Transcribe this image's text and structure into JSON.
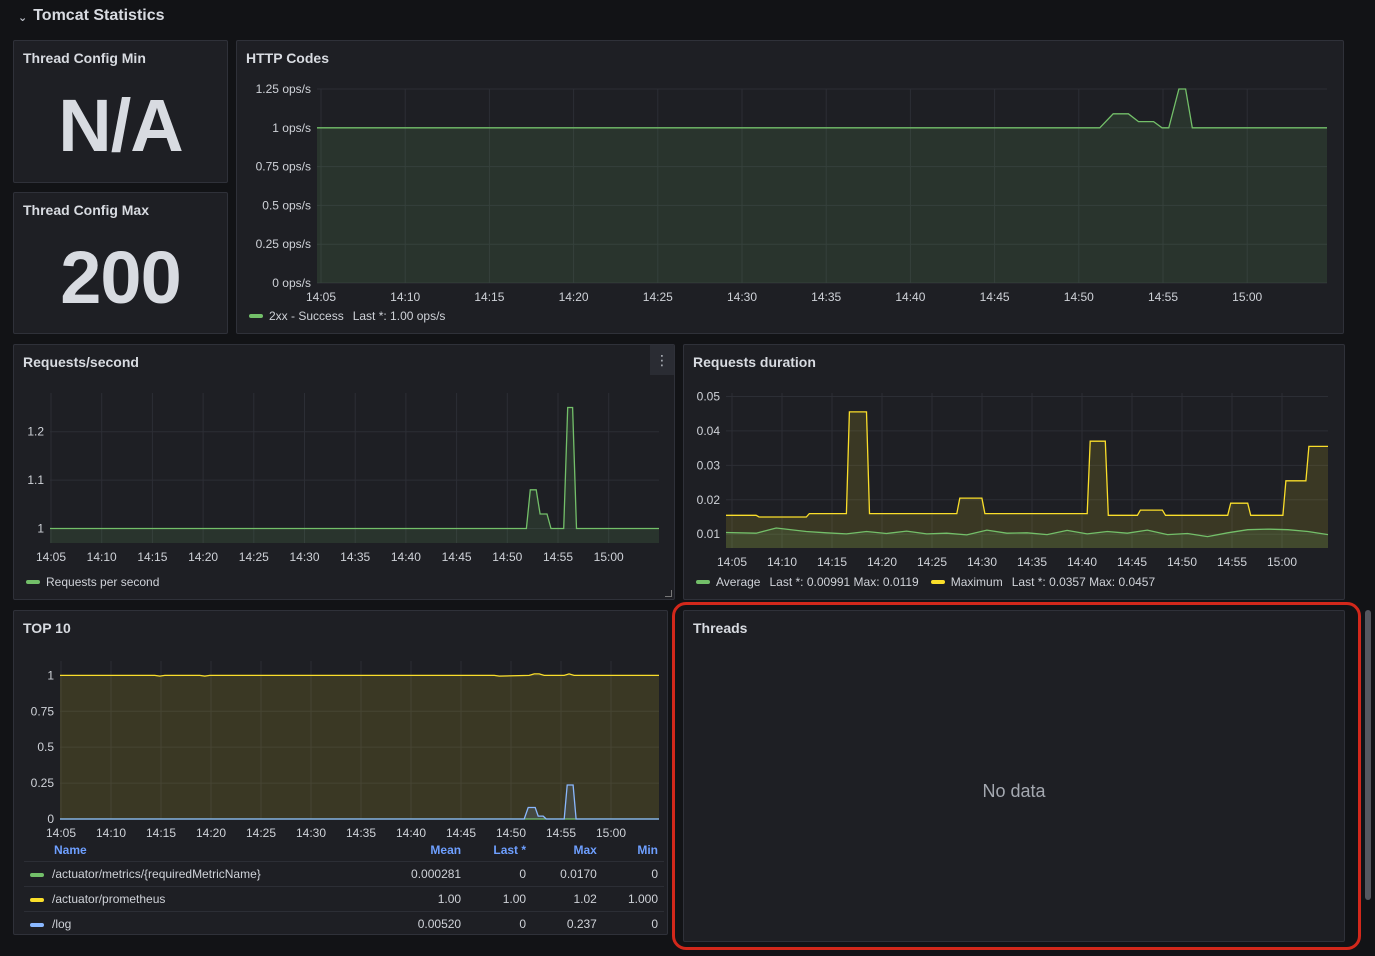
{
  "row": {
    "title": "Tomcat Statistics"
  },
  "colors": {
    "green": "#73bf69",
    "yellow": "#fade2a",
    "blue": "#8ab8ff",
    "red_highlight": "#d2281b"
  },
  "stat_min": {
    "title": "Thread Config Min",
    "value": "N/A"
  },
  "stat_max": {
    "title": "Thread Config Max",
    "value": "200"
  },
  "http_codes": {
    "title": "HTTP Codes",
    "legend": {
      "name": "2xx - Success",
      "stats": "Last *: 1.00 ops/s"
    }
  },
  "requests_second": {
    "title": "Requests/second",
    "menu_icon": "kebab-menu-icon",
    "legend": {
      "name": "Requests per second"
    }
  },
  "requests_duration": {
    "title": "Requests duration",
    "legend": [
      {
        "name": "Average",
        "stats": "Last *: 0.00991  Max: 0.0119",
        "color": "#73bf69"
      },
      {
        "name": "Maximum",
        "stats": "Last *: 0.0357  Max: 0.0457",
        "color": "#fade2a"
      }
    ]
  },
  "top10": {
    "title": "TOP 10",
    "table": {
      "headers": [
        "Name",
        "Mean",
        "Last *",
        "Max",
        "Min"
      ],
      "rows": [
        {
          "name": "/actuator/metrics/{requiredMetricName}",
          "mean": "0.000281",
          "last": "0",
          "max": "0.0170",
          "min": "0",
          "color": "#73bf69"
        },
        {
          "name": "/actuator/prometheus",
          "mean": "1.00",
          "last": "1.00",
          "max": "1.02",
          "min": "1.000",
          "color": "#fade2a"
        },
        {
          "name": "/log",
          "mean": "0.00520",
          "last": "0",
          "max": "0.237",
          "min": "0",
          "color": "#8ab8ff"
        }
      ]
    }
  },
  "threads": {
    "title": "Threads",
    "empty_text": "No data"
  },
  "chart_data": [
    {
      "type": "area",
      "title": "HTTP Codes",
      "x_ticks": [
        "14:05",
        "14:10",
        "14:15",
        "14:20",
        "14:25",
        "14:30",
        "14:35",
        "14:40",
        "14:45",
        "14:50",
        "14:55",
        "15:00"
      ],
      "y_ticks": [
        "0 ops/s",
        "0.25 ops/s",
        "0.5 ops/s",
        "0.75 ops/s",
        "1 ops/s",
        "1.25 ops/s"
      ],
      "ylim": [
        0,
        1.25
      ],
      "xlim": [
        0,
        60
      ],
      "series": [
        {
          "name": "2xx - Success",
          "color": "#73bf69",
          "x": [
            0,
            46.5,
            47.3,
            48.2,
            48.8,
            49.7,
            50.2,
            50.6,
            51.2,
            51.6,
            52.0,
            60
          ],
          "y": [
            1,
            1,
            1.09,
            1.09,
            1.04,
            1.04,
            1,
            1,
            1.25,
            1.25,
            1,
            1
          ]
        }
      ]
    },
    {
      "type": "line",
      "title": "Requests/second",
      "x_ticks": [
        "14:05",
        "14:10",
        "14:15",
        "14:20",
        "14:25",
        "14:30",
        "14:35",
        "14:40",
        "14:45",
        "14:50",
        "14:55",
        "15:00"
      ],
      "y_ticks": [
        "1",
        "1.1",
        "1.2"
      ],
      "ylim": [
        0.97,
        1.28
      ],
      "xlim": [
        0,
        62
      ],
      "series": [
        {
          "name": "Requests per second",
          "color": "#73bf69",
          "x": [
            0,
            48.5,
            48.9,
            49.5,
            49.9,
            50.6,
            51.0,
            52.3,
            52.7,
            53.2,
            53.6,
            62
          ],
          "y": [
            1,
            1,
            1.08,
            1.08,
            1.03,
            1.03,
            1,
            1,
            1.25,
            1.25,
            1,
            1
          ]
        }
      ]
    },
    {
      "type": "line",
      "title": "Requests duration",
      "x_ticks": [
        "14:05",
        "14:10",
        "14:15",
        "14:20",
        "14:25",
        "14:30",
        "14:35",
        "14:40",
        "14:45",
        "14:50",
        "14:55",
        "15:00"
      ],
      "y_ticks": [
        "0.01",
        "0.02",
        "0.03",
        "0.04",
        "0.05"
      ],
      "ylim": [
        0.006,
        0.051
      ],
      "xlim": [
        0,
        60
      ],
      "series": [
        {
          "name": "Maximum",
          "color": "#fade2a",
          "x": [
            0,
            3,
            3.3,
            8,
            8.3,
            12,
            12.3,
            14,
            14.3,
            23,
            23.3,
            25.5,
            25.8,
            36,
            36.3,
            37.8,
            38.1,
            41,
            41.3,
            43.5,
            43.8,
            50,
            50.3,
            52,
            52.3,
            55.5,
            55.8,
            57.8,
            58.1,
            60
          ],
          "y": [
            0.0155,
            0.0155,
            0.015,
            0.015,
            0.016,
            0.016,
            0.0455,
            0.0455,
            0.016,
            0.016,
            0.0205,
            0.0205,
            0.016,
            0.016,
            0.037,
            0.037,
            0.0155,
            0.0155,
            0.017,
            0.017,
            0.0155,
            0.0155,
            0.019,
            0.019,
            0.0155,
            0.0155,
            0.0255,
            0.0255,
            0.0355,
            0.0355
          ]
        },
        {
          "name": "Average",
          "color": "#73bf69",
          "x": [
            0,
            3,
            5,
            8,
            10,
            12,
            14,
            16,
            18,
            20,
            22,
            24,
            26,
            28,
            30,
            32,
            34,
            36,
            38,
            40,
            42,
            44,
            46,
            48,
            50,
            52,
            54,
            56,
            58,
            60
          ],
          "y": [
            0.0105,
            0.0103,
            0.0118,
            0.0108,
            0.0104,
            0.0101,
            0.0108,
            0.0102,
            0.0109,
            0.0101,
            0.0103,
            0.0098,
            0.0112,
            0.0103,
            0.0104,
            0.0099,
            0.0111,
            0.0101,
            0.0108,
            0.0103,
            0.0112,
            0.0099,
            0.0102,
            0.0093,
            0.0104,
            0.0113,
            0.0115,
            0.0113,
            0.0108,
            0.0099
          ]
        }
      ]
    },
    {
      "type": "line",
      "title": "TOP 10",
      "x_ticks": [
        "14:05",
        "14:10",
        "14:15",
        "14:20",
        "14:25",
        "14:30",
        "14:35",
        "14:40",
        "14:45",
        "14:50",
        "14:55",
        "15:00"
      ],
      "y_ticks": [
        "0",
        "0.25",
        "0.5",
        "0.75",
        "1"
      ],
      "ylim": [
        0,
        1.1
      ],
      "xlim": [
        0,
        60
      ],
      "series": [
        {
          "name": "/actuator/prometheus",
          "color": "#fade2a",
          "x": [
            0,
            9.5,
            10,
            10.5,
            14,
            14.5,
            15,
            43.5,
            44,
            47,
            47.5,
            48,
            48.5,
            50.5,
            51,
            51.5,
            60
          ],
          "y": [
            1,
            1,
            0.995,
            1,
            1,
            0.995,
            1,
            1,
            0.995,
            1,
            1.01,
            1.01,
            1,
            1,
            1.01,
            1,
            1
          ]
        },
        {
          "name": "/actuator/metrics/{requiredMetricName}",
          "color": "#73bf69",
          "x": [
            0,
            60
          ],
          "y": [
            0,
            0
          ]
        },
        {
          "name": "/log",
          "color": "#8ab8ff",
          "x": [
            0,
            46.5,
            46.9,
            47.6,
            47.9,
            48.4,
            48.7,
            50.5,
            50.8,
            51.4,
            51.7,
            60
          ],
          "y": [
            0,
            0,
            0.08,
            0.08,
            0.02,
            0.02,
            0,
            0,
            0.237,
            0.237,
            0,
            0
          ]
        }
      ]
    }
  ]
}
